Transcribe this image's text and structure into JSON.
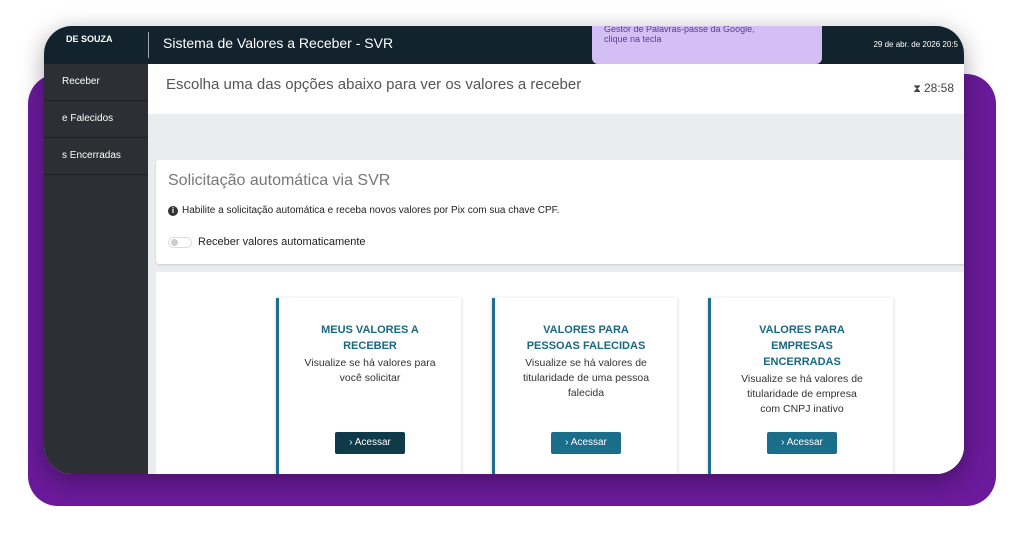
{
  "topbar": {
    "user_name": "DE SOUZA",
    "app_title": "Sistema de Valores a Receber - SVR",
    "datetime": "29 de abr. de 2026 20:5",
    "tooltip_line1": "Gestor de Palavras-passe da Google,",
    "tooltip_line2": "clique na tecla"
  },
  "sidebar": {
    "items": [
      {
        "label": "Receber"
      },
      {
        "label": "e Falecidos"
      },
      {
        "label": "s Encerradas"
      }
    ]
  },
  "main": {
    "heading": "Escolha uma das opções abaixo para ver os valores a receber",
    "timer": "28:58",
    "timer_icon": "hourglass-icon"
  },
  "svr": {
    "title": "Solicitação automática via SVR",
    "info": "Habilite a solicitação automática e receba novos valores por Pix com sua chave CPF.",
    "toggle_label": "Receber valores automaticamente",
    "toggle_on": false
  },
  "options": [
    {
      "title_line1": "MEUS VALORES A",
      "title_line2": "RECEBER",
      "title_line3": "",
      "desc_line1": "Visualize se há valores para",
      "desc_line2": "você solicitar",
      "desc_line3": "",
      "button": "Acessar"
    },
    {
      "title_line1": "VALORES PARA",
      "title_line2": "PESSOAS FALECIDAS",
      "title_line3": "",
      "desc_line1": "Visualize se há valores de",
      "desc_line2": "titularidade de uma pessoa",
      "desc_line3": "falecida",
      "button": "Acessar"
    },
    {
      "title_line1": "VALORES PARA",
      "title_line2": "EMPRESAS",
      "title_line3": "ENCERRADAS",
      "desc_line1": "Visualize se há valores de",
      "desc_line2": "titularidade de empresa",
      "desc_line3": "com CNPJ inativo",
      "button": "Acessar"
    }
  ],
  "colors": {
    "frame_purple": "#6a1a9a",
    "topbar": "#13232d",
    "sidebar": "#2c2f33",
    "accent_teal": "#1a6e8a",
    "title_blue": "#1a6882"
  }
}
